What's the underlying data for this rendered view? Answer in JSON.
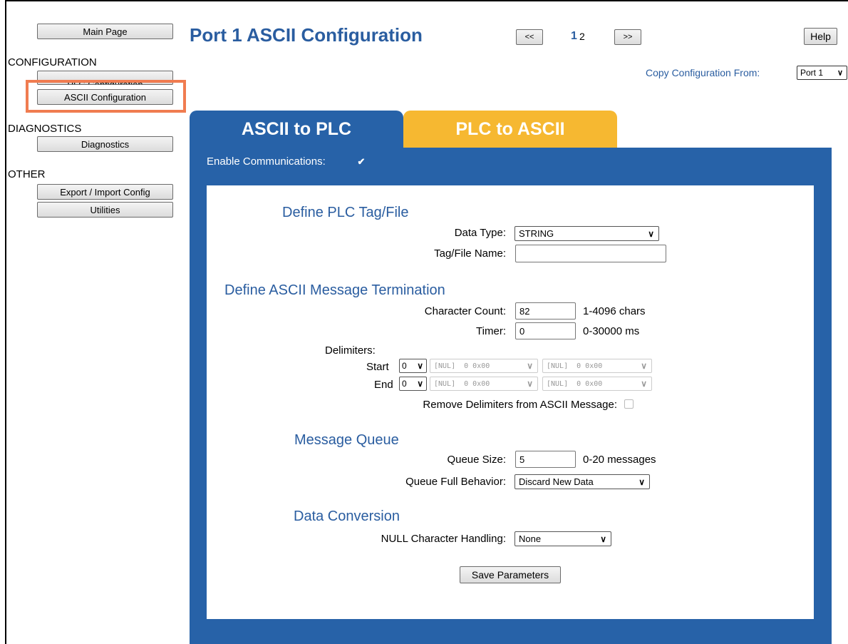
{
  "sidebar": {
    "main_page": "Main Page",
    "configuration_heading": "CONFIGURATION",
    "plc_configuration": "PLC Configuration",
    "ascii_configuration": "ASCII Configuration",
    "diagnostics_heading": "DIAGNOSTICS",
    "diagnostics": "Diagnostics",
    "other_heading": "OTHER",
    "export_import": "Export / Import Config",
    "utilities": "Utilities"
  },
  "header": {
    "title": "Port 1 ASCII Configuration",
    "prev": "<<",
    "page_current": "1",
    "page_other": "2",
    "next": ">>",
    "help": "Help",
    "copy_label": "Copy Configuration From:",
    "copy_value": "Port 1"
  },
  "tabs": {
    "active": "ASCII to PLC",
    "inactive": "PLC to ASCII"
  },
  "form": {
    "enable_label": "Enable Communications:",
    "enable_checked": true,
    "define_tag_title": "Define PLC Tag/File",
    "data_type_label": "Data Type:",
    "data_type_value": "STRING",
    "tag_name_label": "Tag/File Name:",
    "tag_name_value": "",
    "termination_title": "Define ASCII Message Termination",
    "char_count_label": "Character Count:",
    "char_count_value": "82",
    "char_count_hint": "1-4096 chars",
    "timer_label": "Timer:",
    "timer_value": "0",
    "timer_hint": "0-30000 ms",
    "delimiters_label": "Delimiters:",
    "start_label": "Start",
    "start_count": "0",
    "end_label": "End",
    "end_count": "0",
    "delim_option": "[NUL]  0 0x00",
    "remove_delims_label": "Remove Delimiters from ASCII Message:",
    "queue_title": "Message Queue",
    "queue_size_label": "Queue Size:",
    "queue_size_value": "5",
    "queue_size_hint": "0-20 messages",
    "queue_full_label": "Queue Full Behavior:",
    "queue_full_value": "Discard New Data",
    "conversion_title": "Data Conversion",
    "null_label": "NULL Character Handling:",
    "null_value": "None",
    "save": "Save Parameters"
  },
  "colors": {
    "accent_blue": "#2762a8",
    "tab_orange": "#f6b831",
    "highlight": "#f07c50"
  }
}
